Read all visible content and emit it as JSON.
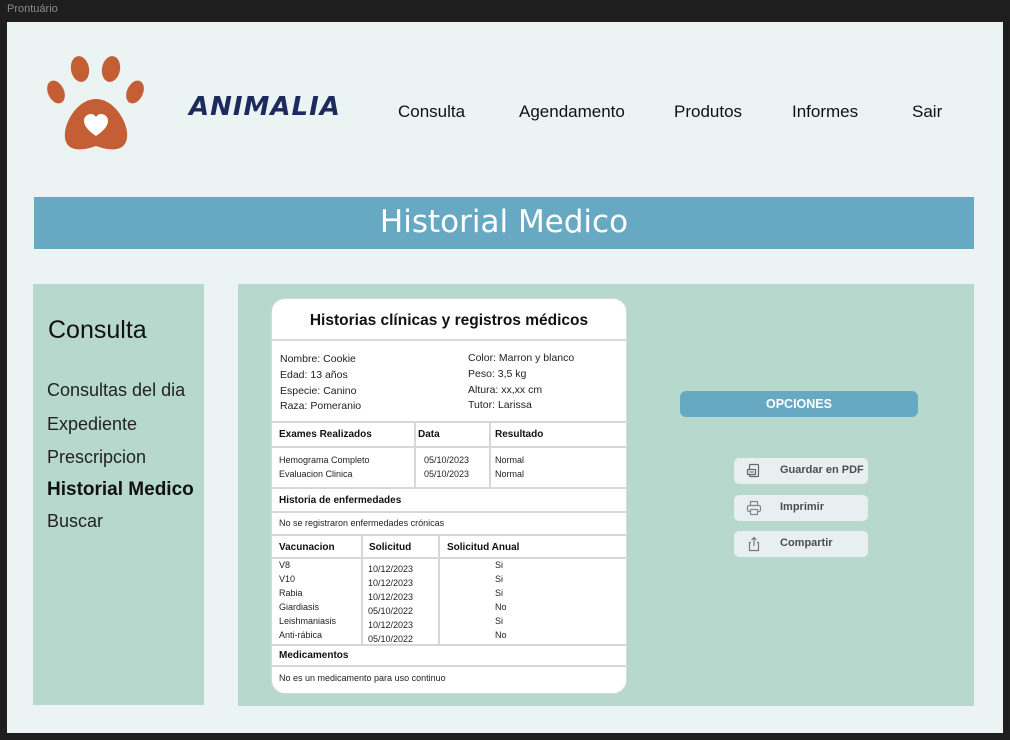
{
  "window": {
    "title": "Prontuário"
  },
  "brand": {
    "name": "ANIMALIA"
  },
  "nav": [
    "Consulta",
    "Agendamento",
    "Produtos",
    "Informes",
    "Sair"
  ],
  "page": {
    "title": "Historial Medico"
  },
  "sidebar": {
    "title": "Consulta",
    "items": [
      "Consultas del dia",
      "Expediente",
      "Prescripcion",
      "Historial Medico",
      "Buscar"
    ],
    "active": "Historial Medico"
  },
  "record": {
    "title": "Historias clínicas y registros médicos",
    "patient_left": [
      "Nombre: Cookie",
      "Edad: 13 años",
      "Especie: Canino",
      "Raza: Pomeranio"
    ],
    "patient_right": [
      "Color: Marron y blanco",
      "Peso: 3,5 kg",
      "Altura: xx,xx cm",
      "Tutor: Larissa"
    ],
    "exams": {
      "headers": [
        "Exames Realizados",
        "Data",
        "Resultado"
      ],
      "rows": [
        [
          "Hemograma Completo",
          "05/10/2023",
          "Normal"
        ],
        [
          "Evaluacion Clinica",
          "05/10/2023",
          "Normal"
        ]
      ]
    },
    "disease_history": {
      "header": "Historia de enfermedades",
      "text": "No se registraron enfermedades crónicas"
    },
    "vaccines": {
      "headers": [
        "Vacunacion",
        "Solicitud",
        "Solicitud Anual"
      ],
      "rows": [
        [
          "V8",
          "10/12/2023",
          "Si"
        ],
        [
          "V10",
          "10/12/2023",
          "Si"
        ],
        [
          "Rabia",
          "10/12/2023",
          "Si"
        ],
        [
          "Giardiasis",
          "05/10/2022",
          "No"
        ],
        [
          "Leishmaniasis",
          "10/12/2023",
          "Si"
        ],
        [
          "Anti-rábica",
          "05/10/2022",
          "No"
        ]
      ]
    },
    "medications": {
      "header": "Medicamentos",
      "text": "No es un medicamento para uso continuo"
    }
  },
  "options": {
    "title": "OPCIONES",
    "buttons": [
      {
        "label": "Guardar en PDF",
        "icon": "pdf-icon"
      },
      {
        "label": "Imprimir",
        "icon": "printer-icon"
      },
      {
        "label": "Compartir",
        "icon": "share-icon"
      }
    ]
  },
  "colors": {
    "banner": "#67a9c3",
    "panel": "#b6d8cd",
    "background": "#ecf3f3",
    "logo": "#c35e35",
    "brand": "#1c2a5e"
  }
}
